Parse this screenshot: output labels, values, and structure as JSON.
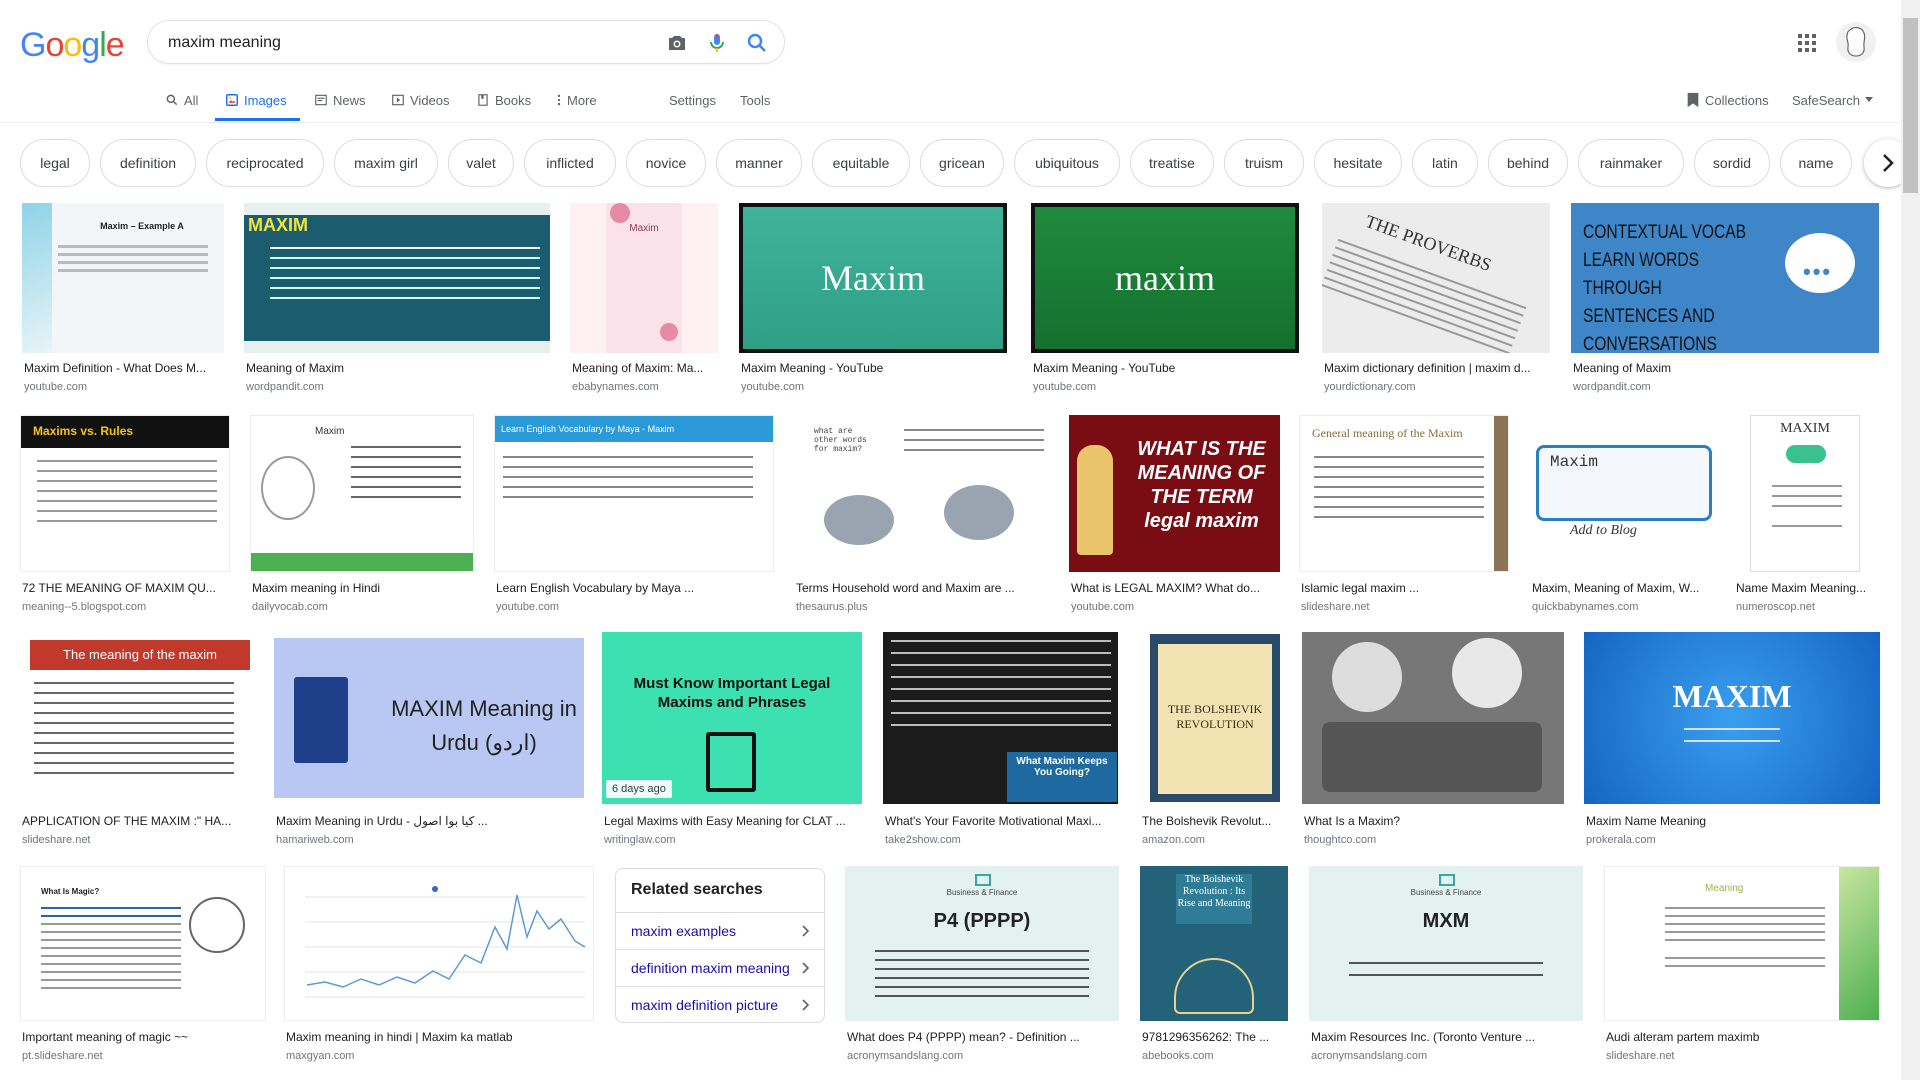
{
  "search": {
    "query": "maxim meaning"
  },
  "logo": {
    "letters": [
      "G",
      "o",
      "o",
      "g",
      "l",
      "e"
    ],
    "colors": [
      "#4285f4",
      "#ea4335",
      "#fbbc05",
      "#4285f4",
      "#34a853",
      "#ea4335"
    ]
  },
  "tabs": {
    "all": "All",
    "images": "Images",
    "news": "News",
    "videos": "Videos",
    "books": "Books",
    "more": "More",
    "settings": "Settings",
    "tools": "Tools"
  },
  "header_right": {
    "collections": "Collections",
    "safesearch": "SafeSearch"
  },
  "chips": [
    "legal",
    "definition",
    "reciprocated",
    "maxim girl",
    "valet",
    "inflicted",
    "novice",
    "manner",
    "equitable",
    "gricean",
    "ubiquitous",
    "treatise",
    "truism",
    "hesitate",
    "latin",
    "behind",
    "rainmaker",
    "sordid",
    "name"
  ],
  "results": [
    {
      "title": "Maxim Definition - What Does M...",
      "source": "youtube.com",
      "thumb_text": "Maxim – Example A"
    },
    {
      "title": "Meaning of Maxim",
      "source": "wordpandit.com",
      "thumb_text": "MAXIM"
    },
    {
      "title": "Meaning of Maxim: Ma...",
      "source": "ebabynames.com",
      "thumb_text": "Maxim"
    },
    {
      "title": "Maxim Meaning - YouTube",
      "source": "youtube.com",
      "thumb_text": "Maxim"
    },
    {
      "title": "Maxim Meaning - YouTube",
      "source": "youtube.com",
      "thumb_text": "maxim"
    },
    {
      "title": "Maxim dictionary definition | maxim d...",
      "source": "yourdictionary.com",
      "thumb_text": "THE PROVERBS"
    },
    {
      "title": "Meaning of Maxim",
      "source": "wordpandit.com",
      "thumb_text": "CONTEXTUAL VOCAB LEARN WORDS THROUGH SENTENCES AND CONVERSATIONS"
    },
    {
      "title": "72 THE MEANING OF MAXIM QU...",
      "source": "meaning--5.blogspot.com",
      "thumb_text": "Maxims vs. Rules"
    },
    {
      "title": "Maxim meaning in Hindi",
      "source": "dailyvocab.com",
      "thumb_text": "Maxim"
    },
    {
      "title": "Learn English Vocabulary by Maya ...",
      "source": "youtube.com",
      "thumb_text": "Learn English Vocabulary by Maya - Maxim"
    },
    {
      "title": "Terms Household word and Maxim are ...",
      "source": "thesaurus.plus",
      "thumb_text": "what are other words for maxim?"
    },
    {
      "title": "What is LEGAL MAXIM? What do...",
      "source": "youtube.com",
      "thumb_text": "WHAT IS THE MEANING OF THE TERM legal maxim"
    },
    {
      "title": "Islamic legal maxim ...",
      "source": "slideshare.net",
      "thumb_text": "General meaning of the Maxim"
    },
    {
      "title": "Maxim, Meaning of Maxim, W...",
      "source": "quickbabynames.com",
      "thumb_text": "Maxim"
    },
    {
      "title": "Name Maxim Meaning...",
      "source": "numeroscop.net",
      "thumb_text": "MAXIM"
    },
    {
      "title": "APPLICATION OF THE MAXIM :\" HA...",
      "source": "slideshare.net",
      "thumb_text": "The meaning of the maxim"
    },
    {
      "title": "Maxim Meaning in Urdu - كيا بوا اصول ...",
      "source": "hamariweb.com",
      "thumb_text": "MAXIM Meaning in Urdu (اردو)"
    },
    {
      "title": "Legal Maxims with Easy Meaning for CLAT ...",
      "source": "writinglaw.com",
      "thumb_text": "Must Know Important Legal Maxims and Phrases",
      "badge": "6 days ago"
    },
    {
      "title": "What's Your Favorite Motivational Maxi...",
      "source": "take2show.com",
      "thumb_text": "What Maxim Keeps You Going?"
    },
    {
      "title": "The Bolshevik Revolut...",
      "source": "amazon.com",
      "thumb_text": "THE BOLSHEVIK REVOLUTION"
    },
    {
      "title": "What Is a Maxim?",
      "source": "thoughtco.com",
      "thumb_text": ""
    },
    {
      "title": "Maxim Name Meaning",
      "source": "prokerala.com",
      "thumb_text": "MAXIM"
    },
    {
      "title": "Important meaning of magic ~~",
      "source": "pt.slideshare.net",
      "thumb_text": "What Is Magic?"
    },
    {
      "title": "Maxim meaning in hindi | Maxim ka matlab",
      "source": "maxgyan.com",
      "thumb_text": ""
    },
    {
      "title": "What does P4 (PPPP) mean? - Definition ...",
      "source": "acronymsandslang.com",
      "thumb_text": "P4 (PPPP)"
    },
    {
      "title": "9781296356262: The ...",
      "source": "abebooks.com",
      "thumb_text": "The Bolshevik Revolution : Its Rise and Meaning"
    },
    {
      "title": "Maxim Resources Inc. (Toronto Venture ...",
      "source": "acronymsandslang.com",
      "thumb_text": "MXM"
    },
    {
      "title": "Audi alteram partem maximb",
      "source": "slideshare.net",
      "thumb_text": "Meaning"
    }
  ],
  "related": {
    "heading": "Related searches",
    "items": [
      "maxim examples",
      "definition maxim meaning",
      "maxim definition picture"
    ]
  },
  "colors": {
    "accent": "#1a73e8",
    "link": "#1a0dab"
  }
}
